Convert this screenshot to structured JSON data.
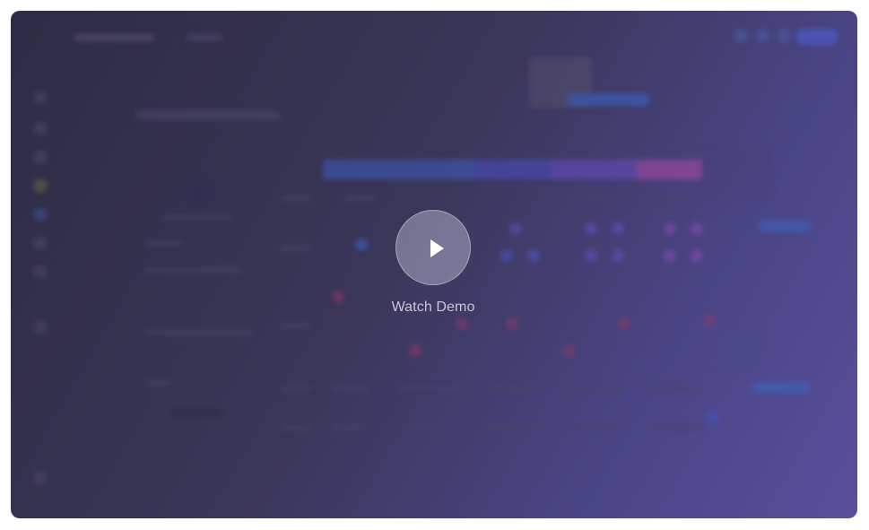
{
  "overlay": {
    "play_icon": "play-icon",
    "label": "Watch Demo"
  },
  "colors": {
    "gradient_start": "#2e2c45",
    "gradient_end": "#5a4f9b",
    "accent": "#4a63d8"
  }
}
